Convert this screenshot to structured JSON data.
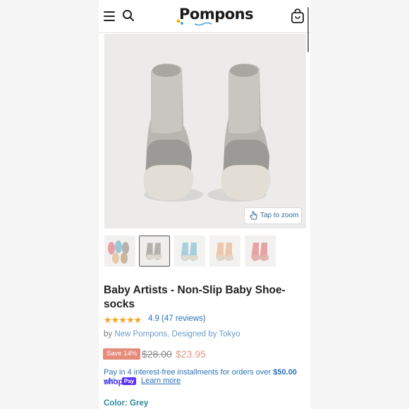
{
  "header": {
    "logo_text": "Pompons",
    "icons": [
      "menu-icon",
      "search-icon",
      "cart-icon"
    ]
  },
  "gallery": {
    "zoom_label": "Tap to zoom",
    "thumbnail_count": 5,
    "selected_thumbnail": 2
  },
  "product": {
    "title": "Baby Artists - Non-Slip Baby Shoe-socks",
    "stars": "★★★★★",
    "rating": "4.9",
    "reviews": "(47 reviews)",
    "by_prefix": "by",
    "vendor": "New Pompons, Designed by Tokyo",
    "save_badge": "Save 14%",
    "price_original": "$28.00",
    "price_sale": "$23.95",
    "installments_text": "Pay in 4 interest-free installments for orders over",
    "installments_amount": "$50.00",
    "installments_with": "with",
    "shop_label": "shop",
    "pay_label": "Pay",
    "learn_more": "Learn more",
    "color_label": "Color: Grey"
  },
  "colors": {
    "accent_blue": "#2a73b8",
    "sale_price": "#e39685",
    "badge": "#e58b7b",
    "shop_pay": "#5a31f4",
    "color_label": "#2c8b9a",
    "stars": "#f6a623"
  }
}
